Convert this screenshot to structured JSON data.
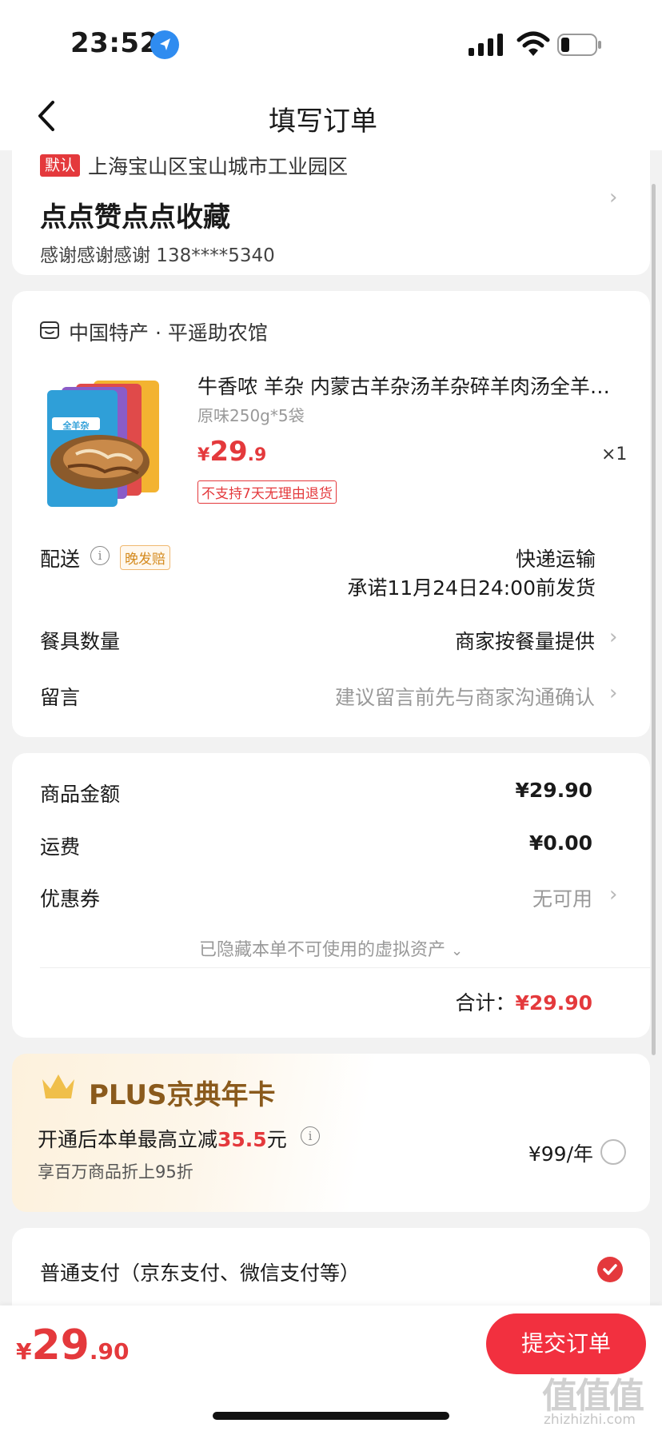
{
  "status_bar": {
    "time": "23:52"
  },
  "nav": {
    "title": "填写订单"
  },
  "address": {
    "default_tag": "默认",
    "region": "上海宝山区宝山城市工业园区",
    "name": "点点赞点点收藏",
    "contact": "感谢感谢感谢  138****5340"
  },
  "store": {
    "name": "中国特产 · 平遥助农馆"
  },
  "product": {
    "title": "牛香哝 羊杂 内蒙古羊杂汤羊杂碎羊肉汤全羊…",
    "spec": "原味250g*5袋",
    "currency": "¥",
    "price_int": "29",
    "price_dec": ".9",
    "qty": "×1",
    "no_return": "不支持7天无理由退货",
    "image_text": "全羊杂"
  },
  "delivery": {
    "label": "配送",
    "late_tag": "晚发赔",
    "method": "快递运输",
    "promise": "承诺11月24日24:00前发货"
  },
  "tableware": {
    "label": "餐具数量",
    "value": "商家按餐量提供"
  },
  "message": {
    "label": "留言",
    "placeholder": "建议留言前先与商家沟通确认"
  },
  "price": {
    "goods_label": "商品金额",
    "goods_value": "¥29.90",
    "freight_label": "运费",
    "freight_value": "¥0.00",
    "coupon_label": "优惠券",
    "coupon_value": "无可用",
    "hidden_assets": "已隐藏本单不可使用的虚拟资产",
    "total_label": "合计：",
    "total_value": "¥29.90"
  },
  "plus": {
    "title": "PLUS京典年卡",
    "desc_prefix": "开通后本单最高立减",
    "desc_amount": "35.5",
    "desc_suffix": "元",
    "sub": "享百万商品折上95折",
    "price": "¥99/年"
  },
  "payment": {
    "label": "普通支付（京东支付、微信支付等）"
  },
  "bottom": {
    "currency": "¥",
    "total_int": "29",
    "total_dec": ".90",
    "submit": "提交订单"
  },
  "watermark": {
    "main": "值值值",
    "sub": "zhizhizhi.com"
  },
  "colors": {
    "accent": "#e4393c",
    "submit": "#f2303f",
    "plus_gold": "#8a5a1c"
  }
}
